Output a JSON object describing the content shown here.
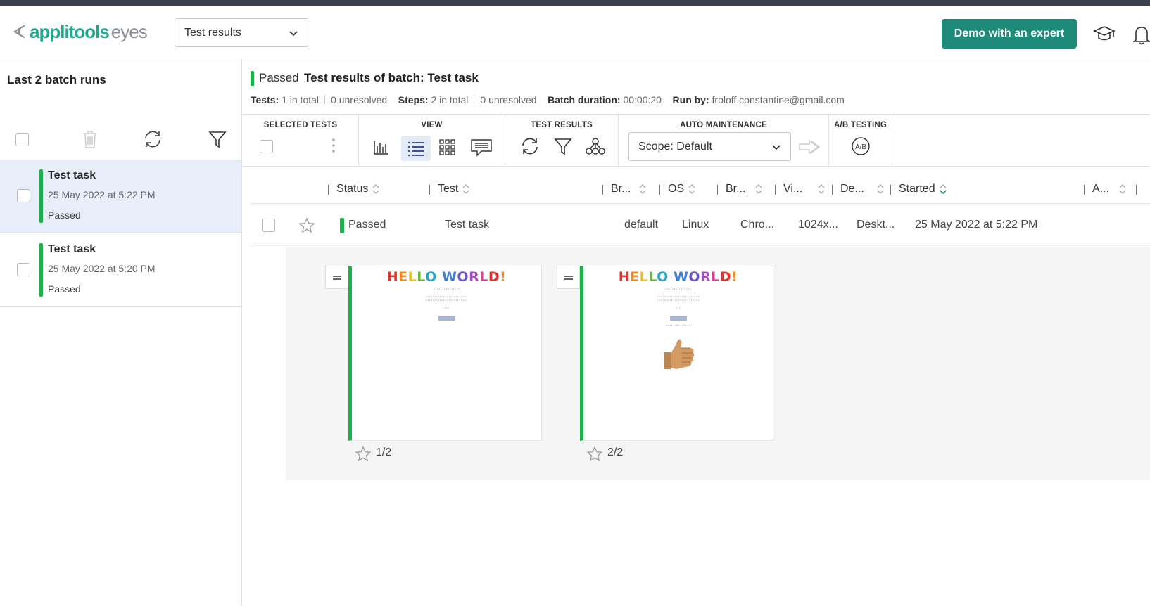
{
  "app": {
    "brand": "applitools",
    "product": "eyes",
    "view_select": "Test results",
    "demo_button": "Demo with an expert"
  },
  "sidebar": {
    "title": "Last 2 batch runs",
    "batches": [
      {
        "name": "Test task",
        "date": "25 May 2022 at 5:22 PM",
        "status": "Passed",
        "selected": true
      },
      {
        "name": "Test task",
        "date": "25 May 2022 at 5:20 PM",
        "status": "Passed",
        "selected": false
      }
    ]
  },
  "batch": {
    "status": "Passed",
    "title": "Test results of batch:  Test task",
    "tests_label": "Tests:",
    "tests_total": "1 in total",
    "tests_unresolved": "0 unresolved",
    "steps_label": "Steps:",
    "steps_total": "2 in total",
    "steps_unresolved": "0 unresolved",
    "duration_label": "Batch duration:",
    "duration": "00:00:20",
    "runby_label": "Run by:",
    "runby": "froloff.constantine@gmail.com"
  },
  "toolbar": {
    "selected_tests": "SELECTED TESTS",
    "view": "VIEW",
    "test_results": "TEST RESULTS",
    "auto_maintenance": "AUTO MAINTENANCE",
    "scope": "Scope: Default",
    "ab_testing": "A/B TESTING"
  },
  "table": {
    "columns": [
      "Status",
      "Test",
      "Br...",
      "OS",
      "Br...",
      "Vi...",
      "De...",
      "Started",
      "A..."
    ],
    "row": {
      "status": "Passed",
      "test": "Test task",
      "branch": "default",
      "os": "Linux",
      "browser": "Chro...",
      "viewport": "1024x...",
      "device": "Deskt...",
      "started": "25 May 2022 at 5:22 PM"
    }
  },
  "steps": [
    {
      "label": "1/2",
      "headline": "HELLO WORLD!"
    },
    {
      "label": "2/2",
      "headline": "HELLO WORLD!"
    }
  ],
  "colors": {
    "accent": "#1d8a7a",
    "passed": "#1eb04a",
    "selected_row": "#e7eef9"
  }
}
